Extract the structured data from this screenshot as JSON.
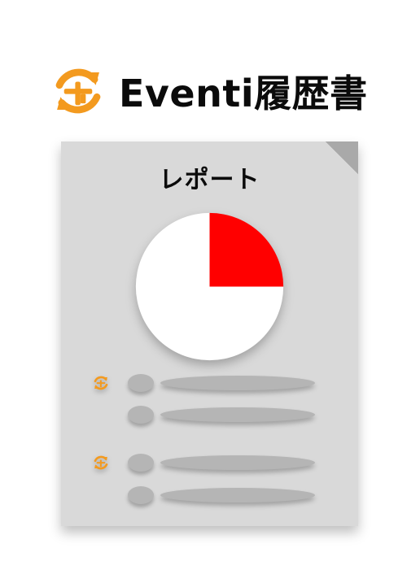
{
  "header": {
    "title": "Eventi履歴書",
    "logo_icon": "eventi-sync-plus-icon",
    "logo_color": "#F39A1F"
  },
  "card": {
    "title": "レポート",
    "background": "#D9D9D9"
  },
  "chart_data": {
    "type": "pie",
    "slices": [
      {
        "value": 0.25,
        "color": "#FF0000"
      },
      {
        "value": 0.75,
        "color": "#FFFFFF"
      }
    ]
  },
  "rows": [
    {
      "has_icon": true
    },
    {
      "has_icon": false
    },
    {
      "has_icon": true
    },
    {
      "has_icon": false
    }
  ]
}
